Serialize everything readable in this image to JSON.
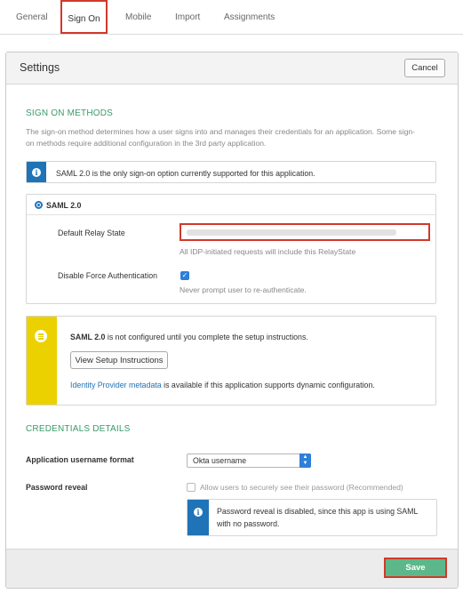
{
  "tabs": [
    {
      "label": "General"
    },
    {
      "label": "Sign On"
    },
    {
      "label": "Mobile"
    },
    {
      "label": "Import"
    },
    {
      "label": "Assignments"
    }
  ],
  "active_tab": "Sign On",
  "settings": {
    "title": "Settings",
    "cancel_label": "Cancel"
  },
  "sign_on_methods": {
    "heading": "SIGN ON METHODS",
    "description_line1": "The sign-on method determines how a user signs into and manages their credentials for an application. Some sign-",
    "description_line2": "on methods require additional configuration in the 3rd party application.",
    "info_message": "SAML 2.0 is the only sign-on option currently supported for this application."
  },
  "saml": {
    "option_label": "SAML 2.0",
    "relay_state_label": "Default Relay State",
    "relay_state_hint": "All IDP-initiated requests will include this RelayState",
    "disable_force_auth_label": "Disable Force Authentication",
    "disable_force_auth_checked": true,
    "disable_force_auth_hint": "Never prompt user to re-authenticate."
  },
  "setup_notice": {
    "bold_text": "SAML 2.0",
    "text": " is not configured until you complete the setup instructions.",
    "button_label": "View Setup Instructions",
    "metadata_link": "Identity Provider metadata",
    "metadata_text": " is available if this application supports dynamic configuration."
  },
  "credentials": {
    "heading": "CREDENTIALS DETAILS",
    "username_format_label": "Application username format",
    "username_format_value": "Okta username",
    "password_reveal_label": "Password reveal",
    "password_reveal_option": "Allow users to securely see their password (Recommended)",
    "password_reveal_checked": false,
    "password_notice_line1": "Password reveal is disabled, since this app is using SAML",
    "password_notice_line2": "with no password."
  },
  "footer": {
    "save_label": "Save"
  },
  "colors": {
    "accent_green": "#3a9a6a",
    "info_blue": "#1f73b7",
    "warning_yellow": "#ecd100",
    "save_green": "#5cb88a",
    "highlight_red": "#d0392b"
  }
}
